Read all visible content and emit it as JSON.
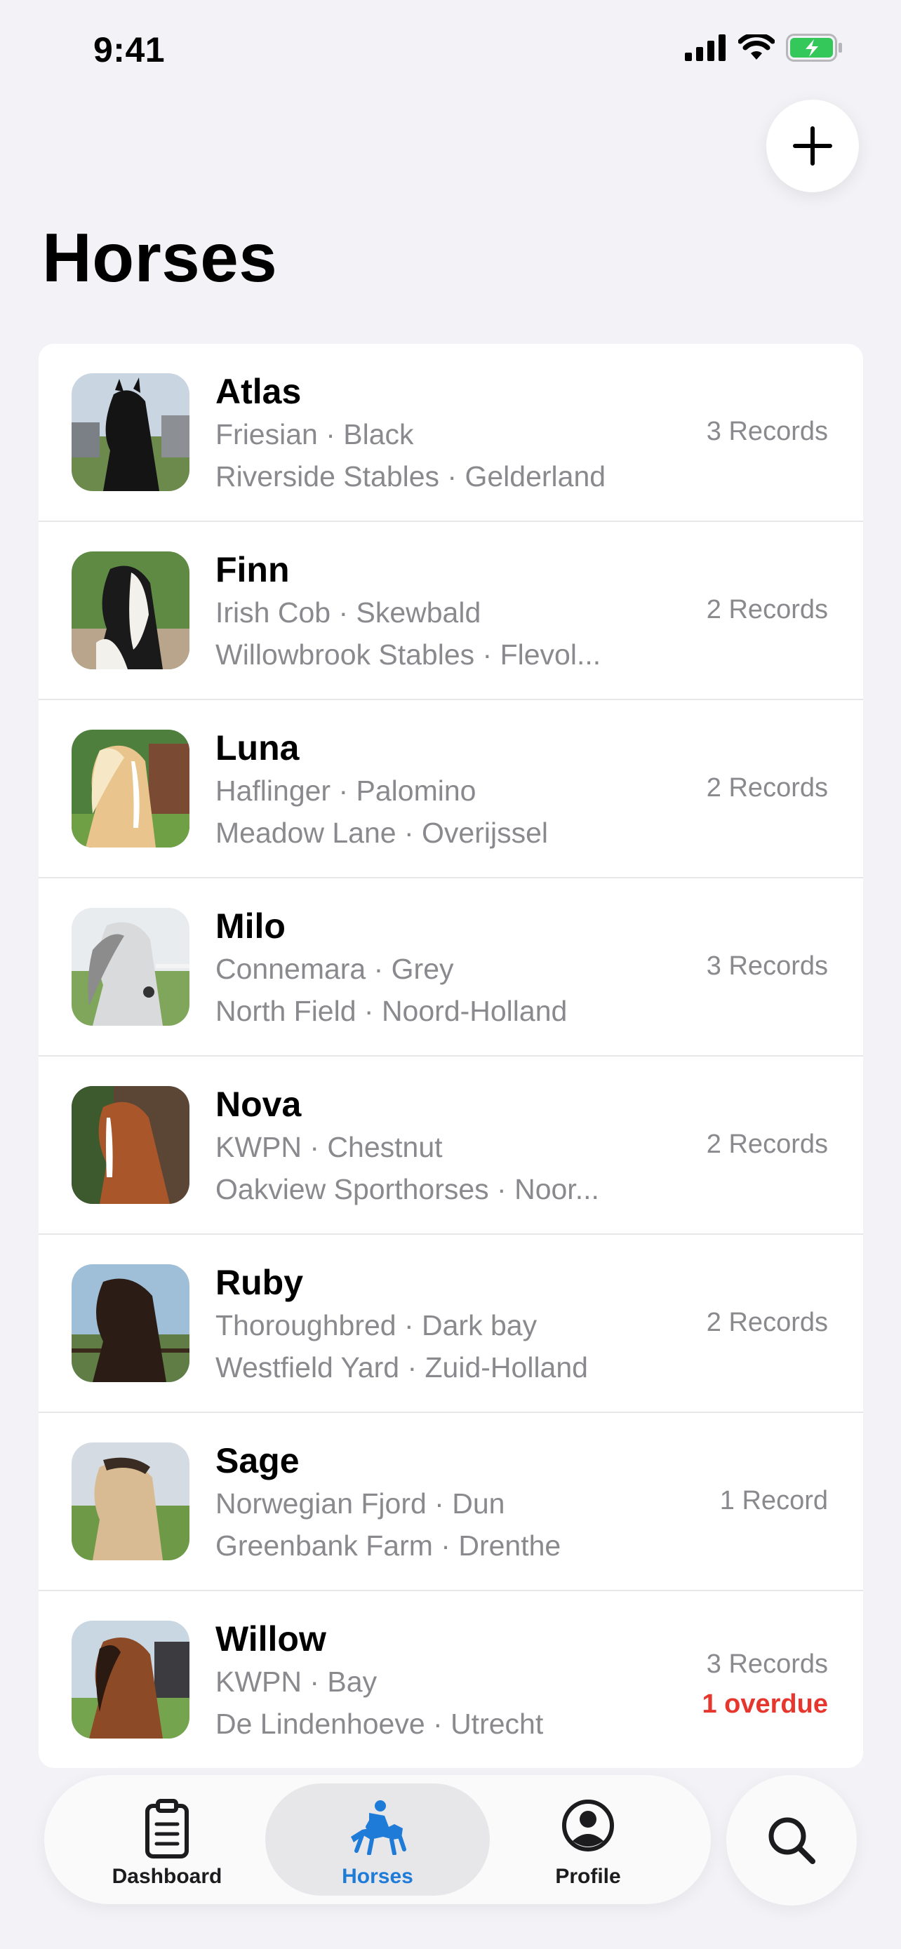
{
  "status_bar": {
    "time": "9:41"
  },
  "header": {
    "title": "Horses"
  },
  "horses": [
    {
      "name": "Atlas",
      "breed_color": "Friesian · Black",
      "location": "Riverside Stables · Gelderland",
      "records": "3 Records",
      "overdue": ""
    },
    {
      "name": "Finn",
      "breed_color": "Irish Cob · Skewbald",
      "location": "Willowbrook Stables · Flevol...",
      "records": "2 Records",
      "overdue": ""
    },
    {
      "name": "Luna",
      "breed_color": "Haflinger · Palomino",
      "location": "Meadow Lane · Overijssel",
      "records": "2 Records",
      "overdue": ""
    },
    {
      "name": "Milo",
      "breed_color": "Connemara · Grey",
      "location": "North Field · Noord-Holland",
      "records": "3 Records",
      "overdue": ""
    },
    {
      "name": "Nova",
      "breed_color": "KWPN · Chestnut",
      "location": "Oakview Sporthorses · Noor...",
      "records": "2 Records",
      "overdue": ""
    },
    {
      "name": "Ruby",
      "breed_color": "Thoroughbred · Dark bay",
      "location": "Westfield Yard · Zuid-Holland",
      "records": "2 Records",
      "overdue": ""
    },
    {
      "name": "Sage",
      "breed_color": "Norwegian Fjord · Dun",
      "location": "Greenbank Farm · Drenthe",
      "records": "1 Record",
      "overdue": ""
    },
    {
      "name": "Willow",
      "breed_color": "KWPN · Bay",
      "location": "De Lindenhoeve · Utrecht",
      "records": "3 Records",
      "overdue": "1 overdue"
    }
  ],
  "tab_bar": {
    "tabs": [
      {
        "label": "Dashboard",
        "icon": "clipboard-icon",
        "active": false
      },
      {
        "label": "Horses",
        "icon": "horse-rider-icon",
        "active": true
      },
      {
        "label": "Profile",
        "icon": "person-circle-icon",
        "active": false
      }
    ]
  },
  "colors": {
    "accent": "#1e7bd8",
    "overdue": "#e5372d",
    "background": "#f2f2f7",
    "battery": "#34c759"
  },
  "icons": {
    "add": "plus-icon",
    "search": "magnifying-glass-icon"
  }
}
